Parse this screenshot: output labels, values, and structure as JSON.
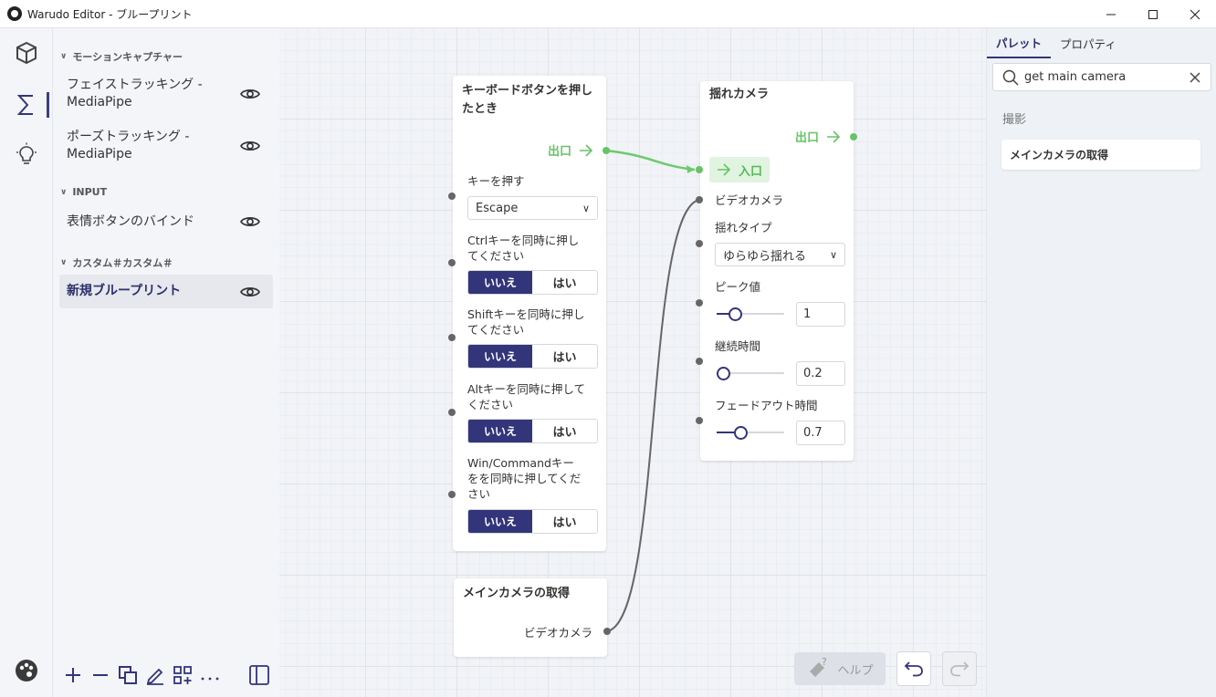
{
  "window": {
    "title": "Warudo Editor - ブループリント"
  },
  "sidebar": {
    "sections": [
      {
        "label": "モーションキャプチャー"
      },
      {
        "label": "INPUT"
      },
      {
        "label": "カスタム＃カスタム＃"
      }
    ],
    "items": [
      {
        "label": "フェイストラッキング - MediaPipe"
      },
      {
        "label": "ポーズトラッキング - MediaPipe"
      },
      {
        "label": "表情ボタンのバインド"
      },
      {
        "label": "新規ブループリント"
      }
    ]
  },
  "nodes": {
    "keyboard": {
      "title": "キーボードボタンを押したとき",
      "exit_label": "出口",
      "key_label": "キーを押す",
      "key_value": "Escape",
      "ctrl_label": "Ctrlキーを同時に押してください",
      "shift_label": "Shiftキーを同時に押してください",
      "alt_label": "Altキーを同時に押してください",
      "win_label": "Win/Commandキーをを同時に押してください",
      "no_label": "いいえ",
      "yes_label": "はい"
    },
    "shake": {
      "title": "揺れカメラ",
      "exit_label": "出口",
      "enter_label": "入口",
      "camera_label": "ビデオカメラ",
      "type_label": "揺れタイプ",
      "type_value": "ゆらゆら揺れる",
      "peak_label": "ピーク値",
      "peak_value": "1",
      "peak_fraction": 0.22,
      "duration_label": "継続時間",
      "duration_value": "0.2",
      "duration_fraction": 0.0,
      "fade_label": "フェードアウト時間",
      "fade_value": "0.7",
      "fade_fraction": 0.33
    },
    "main_camera": {
      "title": "メインカメラの取得",
      "output_label": "ビデオカメラ"
    }
  },
  "bottom": {
    "help_label": "ヘルプ"
  },
  "right_panel": {
    "tabs": [
      {
        "label": "パレット"
      },
      {
        "label": "プロパティ"
      }
    ],
    "search_value": "get main camera",
    "category": "撮影",
    "results": [
      {
        "label": "メインカメラの取得"
      }
    ]
  }
}
